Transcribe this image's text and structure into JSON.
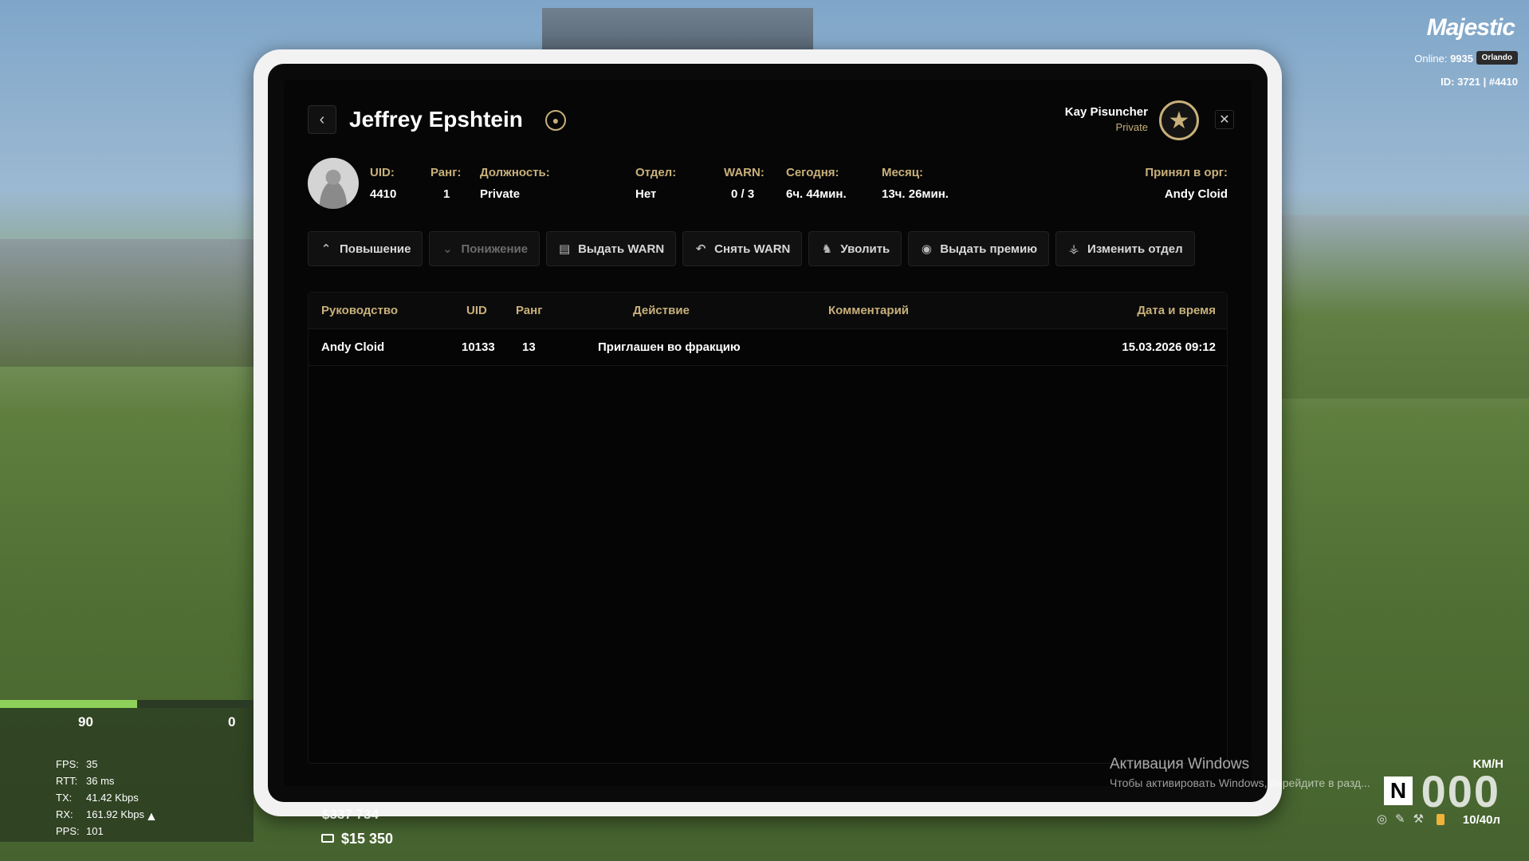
{
  "header": {
    "back_icon": "‹",
    "title": "Jeffrey Epshtein",
    "title_icon": "person-icon",
    "user_name": "Kay Pisuncher",
    "user_rank": "Private",
    "rank_badge": "★",
    "close_icon": "✕"
  },
  "member": {
    "fields": [
      {
        "label": "UID:",
        "value": "4410"
      },
      {
        "label": "Ранг:",
        "value": "1"
      },
      {
        "label": "Должность:",
        "value": "Private"
      },
      {
        "label": "Отдел:",
        "value": "Нет"
      },
      {
        "label": "WARN:",
        "value": "0 / 3"
      },
      {
        "label": "Сегодня:",
        "value": "6ч. 44мин."
      },
      {
        "label": "Месяц:",
        "value": "13ч. 26мин."
      },
      {
        "label": "Принял в орг:",
        "value": "Andy Cloid"
      }
    ]
  },
  "actions": [
    {
      "label": "Повышение",
      "icon": "⌃",
      "disabled": false
    },
    {
      "label": "Понижение",
      "icon": "⌄",
      "disabled": true
    },
    {
      "label": "Выдать WARN",
      "icon": "▤",
      "disabled": false
    },
    {
      "label": "Снять WARN",
      "icon": "↶",
      "disabled": false
    },
    {
      "label": "Уволить",
      "icon": "♞",
      "disabled": false
    },
    {
      "label": "Выдать премию",
      "icon": "◉",
      "disabled": false
    },
    {
      "label": "Изменить отдел",
      "icon": "⚶",
      "disabled": false
    }
  ],
  "log_table": {
    "columns": [
      "Руководство",
      "UID",
      "Ранг",
      "Действие",
      "Комментарий",
      "Дата и время"
    ],
    "rows": [
      [
        "Andy Cloid",
        "10133",
        "13",
        "Приглашен во фракцию",
        "",
        "15.03.2026 09:12"
      ]
    ]
  },
  "hud": {
    "brand": "Majestic",
    "online_label": "Online:",
    "online_count": "9935",
    "server": "Orlando",
    "id_line": "ID: 3721 | #4410",
    "health": "90",
    "armor": "0",
    "health_fraction": 0.54,
    "stats": [
      {
        "k": "FPS:",
        "v": "35"
      },
      {
        "k": "RTT:",
        "v": "36 ms"
      },
      {
        "k": "TX:",
        "v": "41.42 Kbps"
      },
      {
        "k": "RX:",
        "v": "161.92 Kbps"
      },
      {
        "k": "PPS:",
        "v": "101"
      }
    ],
    "bank_partial": "$337 734",
    "cash": "$15 350",
    "speed_unit": "KM/H",
    "gear": "N",
    "speed": "000",
    "fuel": "10/40л"
  },
  "watermark": {
    "title": "Активация Windows",
    "subtitle": "Чтобы активировать Windows, перейдите в разд..."
  },
  "colors": {
    "accent": "#c8b07a",
    "panel_bg": "#060606",
    "health": "#8fd05a"
  }
}
